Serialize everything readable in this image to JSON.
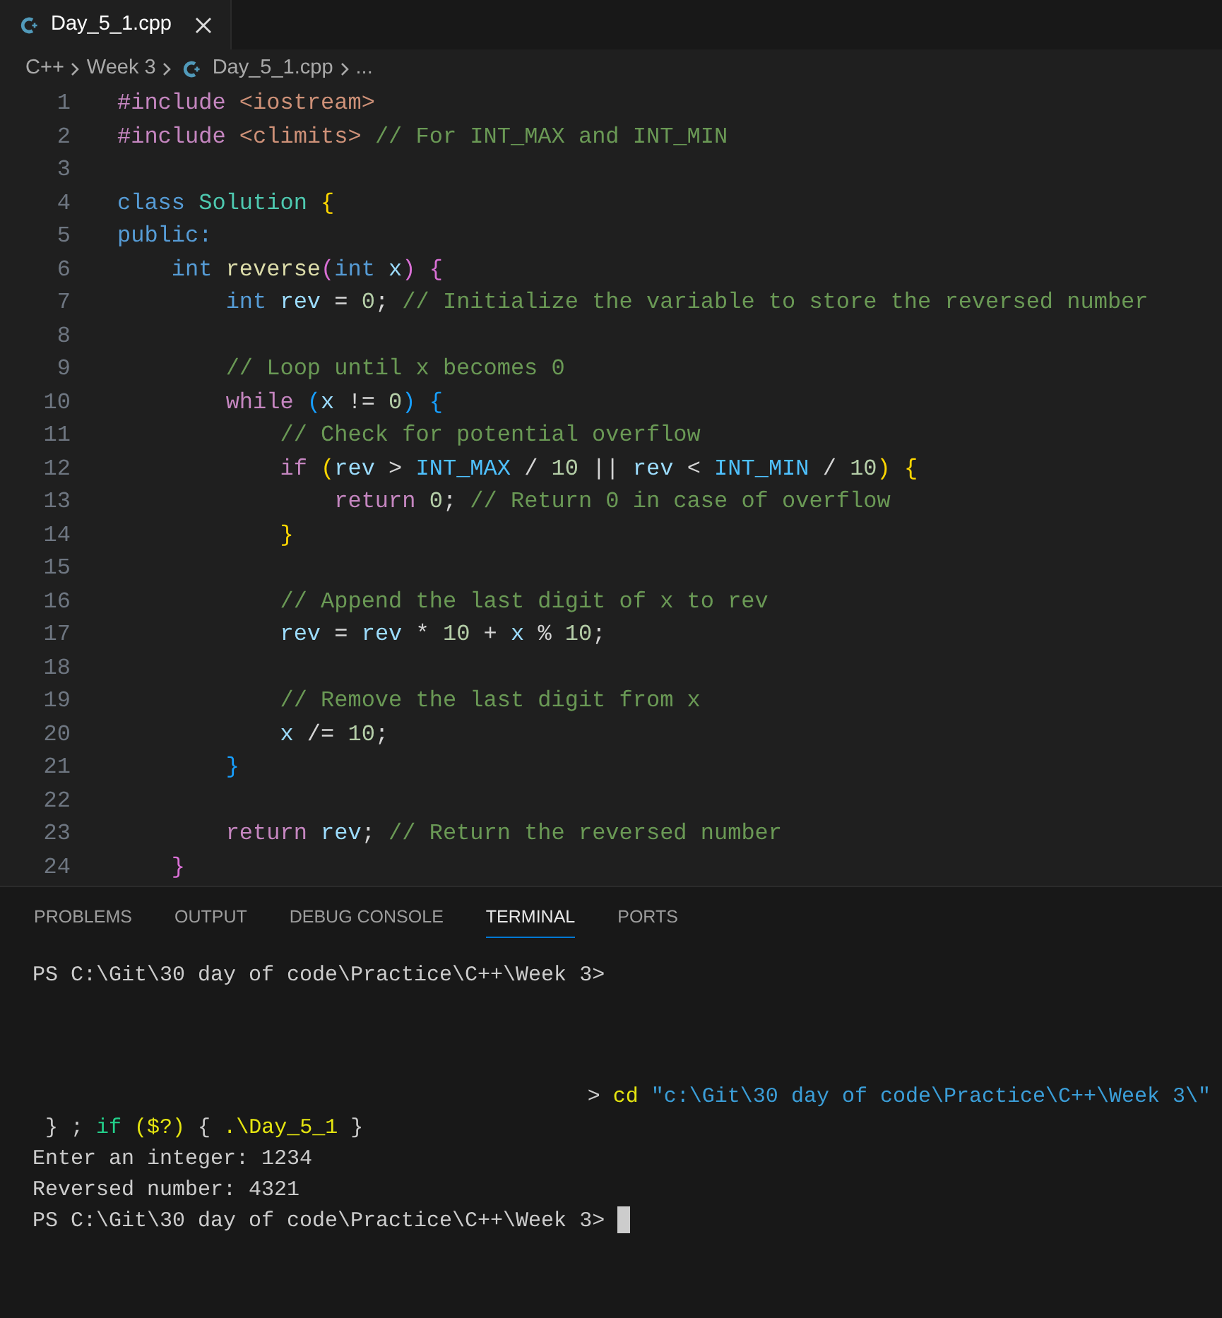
{
  "editor_tabs": [
    {
      "label": "Day_5_1.cpp",
      "selected": true
    }
  ],
  "breadcrumb": [
    "C++",
    "Week 3",
    "Day_5_1.cpp",
    "..."
  ],
  "code_lines": [
    {
      "number": "1",
      "tokens": [
        {
          "text": "#include ",
          "kind": "preproc"
        },
        {
          "text": "<iostream>",
          "kind": "string"
        }
      ]
    },
    {
      "number": "2",
      "tokens": [
        {
          "text": "#include ",
          "kind": "preproc"
        },
        {
          "text": "<climits>",
          "kind": "string"
        },
        {
          "text": " // For INT_MAX and INT_MIN",
          "kind": "comment"
        }
      ]
    },
    {
      "number": "3"
    },
    {
      "number": "4",
      "tokens": [
        {
          "text": "class ",
          "kind": "keyword"
        },
        {
          "text": "Solution ",
          "kind": "type"
        },
        {
          "text": "{",
          "kind": "brace1"
        }
      ]
    },
    {
      "number": "5",
      "tokens": [
        {
          "text": "public:",
          "kind": "keyword"
        }
      ]
    },
    {
      "number": "6",
      "tokens": [
        {
          "text": "    int ",
          "kind": "keyword"
        },
        {
          "text": "reverse",
          "kind": "function"
        },
        {
          "text": "(",
          "kind": "brace2"
        },
        {
          "text": "int ",
          "kind": "keyword"
        },
        {
          "text": "x",
          "kind": "variable"
        },
        {
          "text": ") {",
          "kind": "brace2"
        }
      ]
    },
    {
      "number": "7",
      "tokens": [
        {
          "text": "        int ",
          "kind": "keyword"
        },
        {
          "text": "rev",
          "kind": "variable"
        },
        {
          "text": " = ",
          "kind": "plain"
        },
        {
          "text": "0",
          "kind": "number"
        },
        {
          "text": "; ",
          "kind": "plain"
        },
        {
          "text": "// Initialize the variable to store the reversed number",
          "kind": "comment"
        }
      ]
    },
    {
      "number": "8"
    },
    {
      "number": "9",
      "tokens": [
        {
          "text": "        // Loop until x becomes 0",
          "kind": "comment"
        }
      ]
    },
    {
      "number": "10",
      "tokens": [
        {
          "text": "        while ",
          "kind": "control"
        },
        {
          "text": "(",
          "kind": "brace3"
        },
        {
          "text": "x",
          "kind": "variable"
        },
        {
          "text": " != ",
          "kind": "plain"
        },
        {
          "text": "0",
          "kind": "number"
        },
        {
          "text": ") {",
          "kind": "brace3"
        }
      ]
    },
    {
      "number": "11",
      "tokens": [
        {
          "text": "            // Check for potential overflow",
          "kind": "comment"
        }
      ]
    },
    {
      "number": "12",
      "tokens": [
        {
          "text": "            if ",
          "kind": "control"
        },
        {
          "text": "(",
          "kind": "brace1"
        },
        {
          "text": "rev",
          "kind": "variable"
        },
        {
          "text": " > ",
          "kind": "plain"
        },
        {
          "text": "INT_MAX",
          "kind": "constant"
        },
        {
          "text": " / ",
          "kind": "plain"
        },
        {
          "text": "10",
          "kind": "number"
        },
        {
          "text": " || ",
          "kind": "plain"
        },
        {
          "text": "rev",
          "kind": "variable"
        },
        {
          "text": " < ",
          "kind": "plain"
        },
        {
          "text": "INT_MIN",
          "kind": "constant"
        },
        {
          "text": " / ",
          "kind": "plain"
        },
        {
          "text": "10",
          "kind": "number"
        },
        {
          "text": ") {",
          "kind": "brace1"
        }
      ]
    },
    {
      "number": "13",
      "tokens": [
        {
          "text": "                return ",
          "kind": "control"
        },
        {
          "text": "0",
          "kind": "number"
        },
        {
          "text": "; ",
          "kind": "plain"
        },
        {
          "text": "// Return 0 in case of overflow",
          "kind": "comment"
        }
      ]
    },
    {
      "number": "14",
      "tokens": [
        {
          "text": "            }",
          "kind": "brace1"
        }
      ]
    },
    {
      "number": "15"
    },
    {
      "number": "16",
      "tokens": [
        {
          "text": "            // Append the last digit of x to rev",
          "kind": "comment"
        }
      ]
    },
    {
      "number": "17",
      "tokens": [
        {
          "text": "            rev",
          "kind": "variable"
        },
        {
          "text": " = ",
          "kind": "plain"
        },
        {
          "text": "rev",
          "kind": "variable"
        },
        {
          "text": " * ",
          "kind": "plain"
        },
        {
          "text": "10",
          "kind": "number"
        },
        {
          "text": " + ",
          "kind": "plain"
        },
        {
          "text": "x",
          "kind": "variable"
        },
        {
          "text": " % ",
          "kind": "plain"
        },
        {
          "text": "10",
          "kind": "number"
        },
        {
          "text": ";",
          "kind": "plain"
        }
      ]
    },
    {
      "number": "18"
    },
    {
      "number": "19",
      "tokens": [
        {
          "text": "            // Remove the last digit from x",
          "kind": "comment"
        }
      ]
    },
    {
      "number": "20",
      "tokens": [
        {
          "text": "            x",
          "kind": "variable"
        },
        {
          "text": " /= ",
          "kind": "plain"
        },
        {
          "text": "10",
          "kind": "number"
        },
        {
          "text": ";",
          "kind": "plain"
        }
      ]
    },
    {
      "number": "21",
      "tokens": [
        {
          "text": "        }",
          "kind": "brace3"
        }
      ]
    },
    {
      "number": "22"
    },
    {
      "number": "23",
      "tokens": [
        {
          "text": "        return ",
          "kind": "control"
        },
        {
          "text": "rev",
          "kind": "variable"
        },
        {
          "text": "; ",
          "kind": "plain"
        },
        {
          "text": "// Return the reversed number",
          "kind": "comment"
        }
      ]
    },
    {
      "number": "24",
      "tokens": [
        {
          "text": "    }",
          "kind": "brace2"
        }
      ]
    }
  ],
  "panel_tabs": [
    {
      "label": "PROBLEMS",
      "selected": false
    },
    {
      "label": "OUTPUT",
      "selected": false
    },
    {
      "label": "DEBUG CONSOLE",
      "selected": false
    },
    {
      "label": "TERMINAL",
      "selected": true
    },
    {
      "label": "PORTS",
      "selected": false
    }
  ],
  "terminal_lines": [
    {
      "kind": "output",
      "tokens": [
        {
          "text": "PS C:\\Git\\30 day of code\\Practice\\C++\\Week 3>",
          "kind": "plain"
        }
      ]
    },
    {
      "kind": "wrapped",
      "tokens": [
        {
          "text": "> ",
          "kind": "plain"
        },
        {
          "text": "cd ",
          "kind": "command"
        },
        {
          "text": "\"c:\\Git\\30 day of code\\Practice\\C++\\Week 3\\\"",
          "kind": "string"
        }
      ]
    },
    {
      "kind": "output",
      "tokens": [
        {
          "text": " } ; ",
          "kind": "plain"
        },
        {
          "text": "if ",
          "kind": "keyword"
        },
        {
          "text": "($?)",
          "kind": "command"
        },
        {
          "text": " { ",
          "kind": "plain"
        },
        {
          "text": ".\\Day_5_1",
          "kind": "command"
        },
        {
          "text": " }",
          "kind": "plain"
        }
      ]
    },
    {
      "kind": "output",
      "tokens": [
        {
          "text": "Enter an integer: 1234",
          "kind": "plain"
        }
      ]
    },
    {
      "kind": "output",
      "tokens": [
        {
          "text": "Reversed number: 4321",
          "kind": "plain"
        }
      ]
    },
    {
      "kind": "prompt",
      "tokens": [
        {
          "text": "PS C:\\Git\\30 day of code\\Practice\\C++\\Week 3>",
          "kind": "plain"
        }
      ]
    }
  ]
}
